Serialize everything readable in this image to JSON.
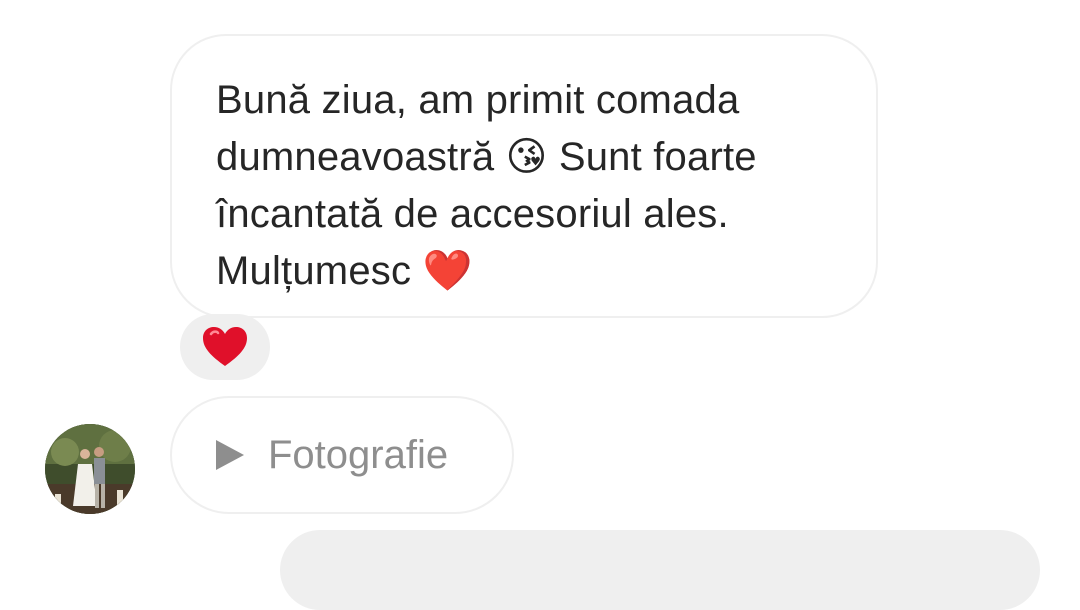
{
  "message": {
    "text": "Bună ziua, am primit comada dumneavoastră 😘 Sunt foarte încantată de accesoriul ales. Mulțumesc ❤️",
    "line1": "Bună ziua, am primit comada",
    "line2": "dumneavoastră 😘 Sunt foarte",
    "line3": "încantată de accesoriul ales.",
    "line4": "Mulțumesc ❤️"
  },
  "reaction": {
    "emoji": "❤️",
    "icon": "heart-icon",
    "color": "#e0102a"
  },
  "attachment": {
    "label": "Fotografie",
    "icon": "play-icon"
  },
  "colors": {
    "bubble_border": "#efefef",
    "reaction_bg": "#efefef",
    "text": "#262626",
    "muted": "#8e8e8e"
  }
}
